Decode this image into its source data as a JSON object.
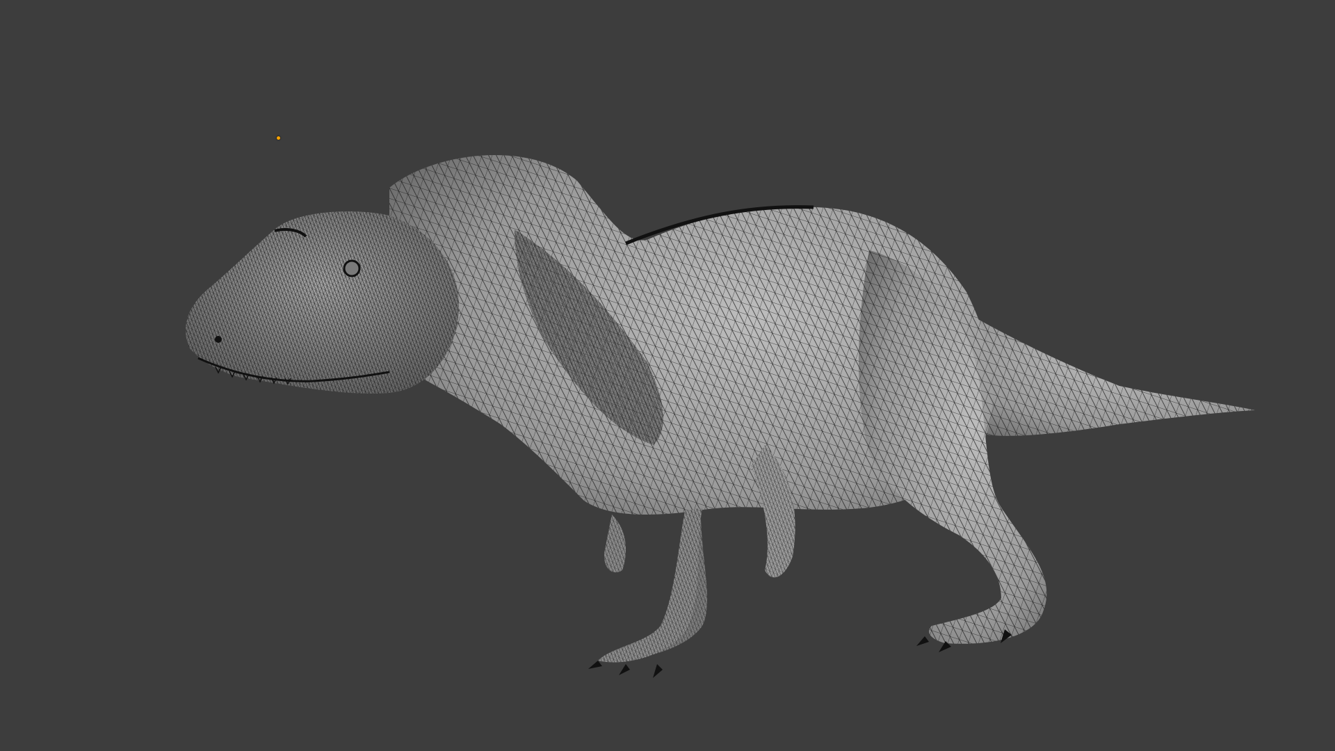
{
  "viewport": {
    "background": "#3d3d3d",
    "shading": "solid",
    "overlay": "wireframe"
  },
  "model": {
    "subject": "tyrannosaurus-mesh",
    "base_color": "#a8a8a8",
    "wire_color": "#1a1a1a"
  },
  "origin_marker": {
    "color": "#ffa500"
  }
}
